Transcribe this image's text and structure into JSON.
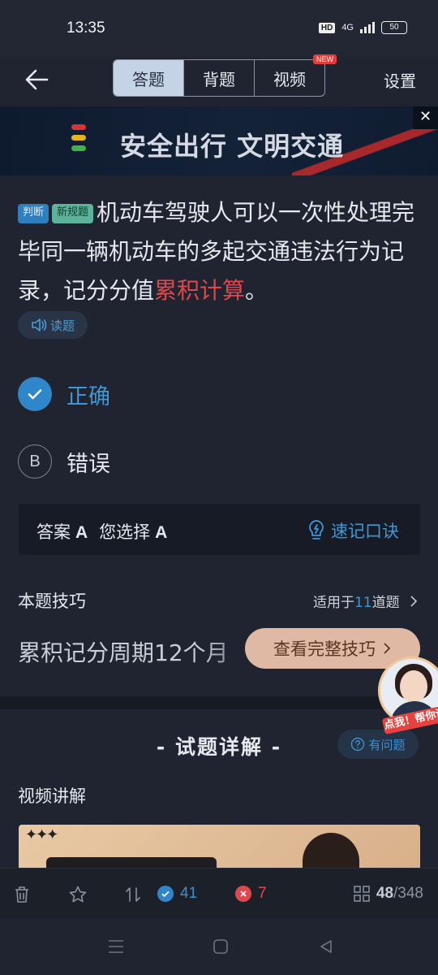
{
  "status": {
    "time": "13:35",
    "hd": "HD",
    "network": "4G",
    "battery": "50"
  },
  "nav": {
    "tabs": [
      {
        "label": "答题"
      },
      {
        "label": "背题"
      },
      {
        "label": "视频"
      }
    ],
    "new_badge": "NEW",
    "settings": "设置"
  },
  "banner": {
    "text": "安全出行  文明交通",
    "close": "✕"
  },
  "question": {
    "tags": [
      "判断",
      "新规题"
    ],
    "text": "机动车驾驶人可以一次性处理完毕同一辆机动车的多起交通违法行为记录，记分分值",
    "highlight": "累积计算",
    "end": "。",
    "read_label": "读题"
  },
  "options": [
    {
      "letter": "A",
      "text": "正确",
      "selected": true
    },
    {
      "letter": "B",
      "text": "错误",
      "selected": false
    }
  ],
  "answer": {
    "answer_label": "答案",
    "answer_value": "A",
    "chosen_label": "您选择",
    "chosen_value": "A",
    "mnemonic": "速记口诀"
  },
  "skill": {
    "title": "本题技巧",
    "apply_prefix": "适用于",
    "apply_count": "11",
    "apply_suffix": "道题",
    "text": "累积记分周期12个月",
    "button": "查看完整技巧"
  },
  "explain": {
    "title": "- 试题详解 -",
    "ask": "有问题",
    "video_title": "视频讲解"
  },
  "helper": {
    "label": "点我！帮你讲"
  },
  "toolbar": {
    "correct": "41",
    "wrong": "7",
    "current": "48",
    "total": "/348"
  },
  "colors": {
    "accent": "#3e97d6",
    "wrong": "#e0474c",
    "background": "#1f2430"
  }
}
